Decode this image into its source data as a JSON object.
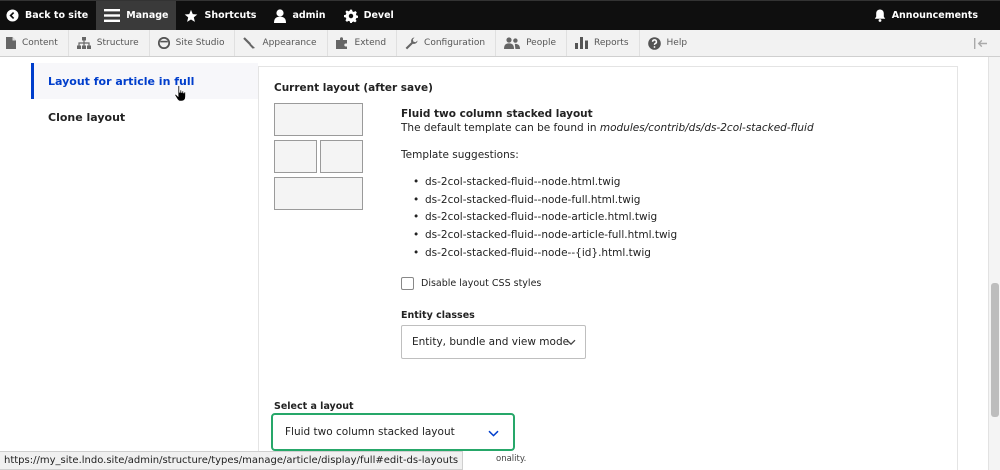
{
  "toolbar": {
    "back_to_site": "Back to site",
    "manage": "Manage",
    "shortcuts": "Shortcuts",
    "user": "admin",
    "devel": "Devel",
    "announcements": "Announcements"
  },
  "tray": {
    "items": [
      "Content",
      "Structure",
      "Site Studio",
      "Appearance",
      "Extend",
      "Configuration",
      "People",
      "Reports",
      "Help"
    ]
  },
  "vertical_tabs": {
    "items": [
      "Layout for article in full",
      "Clone layout"
    ]
  },
  "current_layout": {
    "title": "Current layout (after save)",
    "name": "Fluid two column stacked layout",
    "description_prefix": "The default template can be found in ",
    "description_path": "modules/contrib/ds/ds-2col-stacked-fluid",
    "suggestions_title": "Template suggestions:",
    "suggestions": [
      "ds-2col-stacked-fluid--node.html.twig",
      "ds-2col-stacked-fluid--node-full.html.twig",
      "ds-2col-stacked-fluid--node-article.html.twig",
      "ds-2col-stacked-fluid--node-article-full.html.twig",
      "ds-2col-stacked-fluid--node--{id}.html.twig"
    ]
  },
  "disable_css": {
    "label": "Disable layout CSS styles"
  },
  "entity_classes": {
    "label": "Entity classes",
    "selected": "Entity, bundle and view mode"
  },
  "select_layout": {
    "label": "Select a layout",
    "selected": "Fluid two column stacked layout",
    "description_tail": "onality."
  },
  "status_bar": {
    "url": "https://my_site.lndo.site/admin/structure/types/manage/article/display/full#edit-ds-layouts"
  },
  "colors": {
    "toolbar_bg": "#0f0f0f",
    "active_tab": "#003ecc",
    "focus_border": "#26a769"
  }
}
